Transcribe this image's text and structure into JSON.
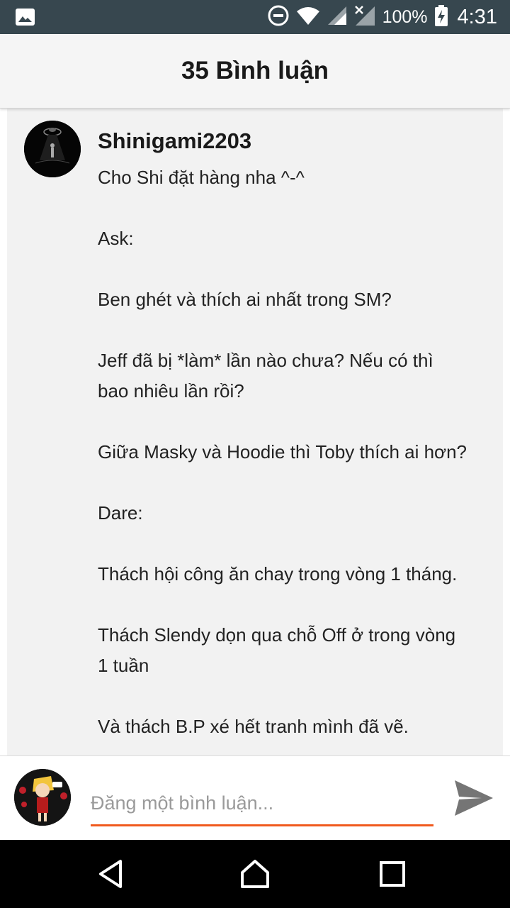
{
  "status_bar": {
    "battery_percent": "100%",
    "time": "4:31",
    "icons": [
      "image-icon",
      "do-not-disturb-icon",
      "wifi-icon",
      "signal-icon",
      "signal-no-data-icon",
      "battery-charging-icon"
    ]
  },
  "header": {
    "title": "35 Bình luận"
  },
  "comment": {
    "author": "Shinigami2203",
    "lines": [
      "Cho Shi đặt hàng nha ^-^",
      "",
      "Ask:",
      "",
      "Ben ghét và thích ai nhất trong SM?",
      "",
      "Jeff đã bị *làm* lần nào chưa? Nếu có thì",
      "bao nhiêu lần rồi?",
      "",
      "Giữa Masky và Hoodie thì Toby thích ai hơn?",
      "",
      "Dare:",
      "",
      "Thách hội công ăn chay trong vòng 1 tháng.",
      "",
      "Thách Slendy dọn qua chỗ Off ở trong vòng",
      "1 tuần",
      "",
      "Và thách B.P xé hết tranh mình đã vẽ."
    ]
  },
  "composer": {
    "placeholder": "Đăng một bình luận...",
    "value": ""
  },
  "colors": {
    "status_bar": "#37474f",
    "accent_underline": "#f05a1e",
    "send_icon": "#757575"
  },
  "nav_bar": {
    "icons": [
      "back-icon",
      "home-icon",
      "recents-icon"
    ]
  }
}
